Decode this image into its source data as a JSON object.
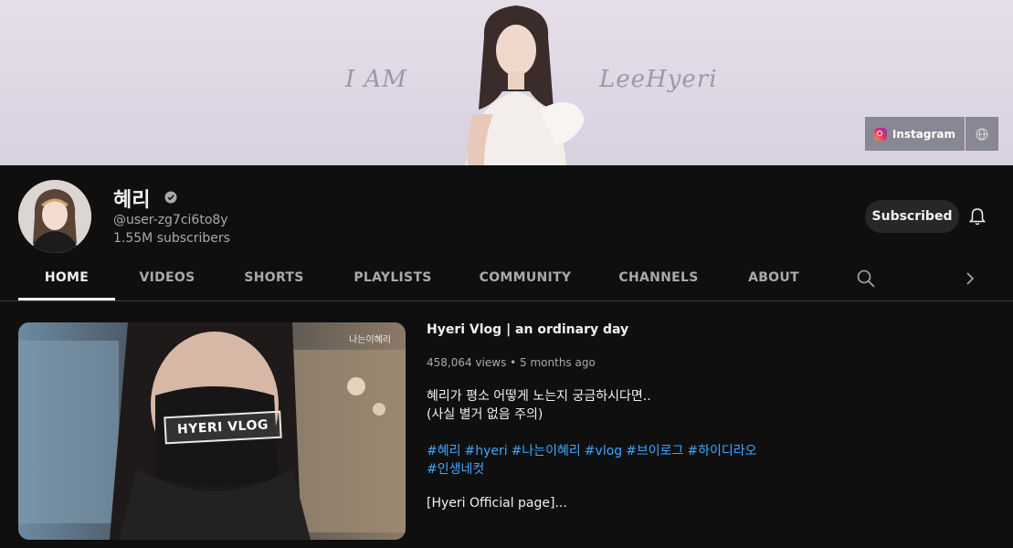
{
  "banner": {
    "left_text": "I AM",
    "right_text": "LeeHyeri",
    "links": [
      {
        "label": "Instagram",
        "icon": "instagram-icon"
      },
      {
        "label": "",
        "icon": "globe-icon"
      }
    ]
  },
  "channel": {
    "name": "혜리",
    "handle": "@user-zg7ci6to8y",
    "subscribers": "1.55M subscribers",
    "subscribe_label": "Subscribed",
    "verified_icon": "verified-check-icon",
    "bell_icon": "bell-icon"
  },
  "tabs": [
    {
      "label": "HOME",
      "active": true
    },
    {
      "label": "VIDEOS",
      "active": false
    },
    {
      "label": "SHORTS",
      "active": false
    },
    {
      "label": "PLAYLISTS",
      "active": false
    },
    {
      "label": "COMMUNITY",
      "active": false
    },
    {
      "label": "CHANNELS",
      "active": false
    },
    {
      "label": "ABOUT",
      "active": false
    }
  ],
  "tab_icons": {
    "search": "search-icon",
    "next": "chevron-right-icon"
  },
  "featured": {
    "thumbnail_label": "HYERI VLOG",
    "thumbnail_corner": "나는이혜리",
    "title": "Hyeri Vlog | an ordinary day",
    "meta": "458,064 views • 5 months ago",
    "description": [
      "혜리가 평소 어떻게 노는지 궁금하시다면..",
      "(사실 별거 없음 주의)"
    ],
    "hashtags_line1": [
      "#혜리",
      "#hyeri",
      "#나는이혜리",
      "#vlog",
      "#브이로그",
      "#하이디라오"
    ],
    "hashtags_line2": [
      "#인생네컷"
    ],
    "more": "[Hyeri Official page]..."
  },
  "colors": {
    "background": "#0f0f0f",
    "link": "#3ea6ff",
    "secondary_text": "#aaaaaa",
    "button_bg": "#272727"
  }
}
